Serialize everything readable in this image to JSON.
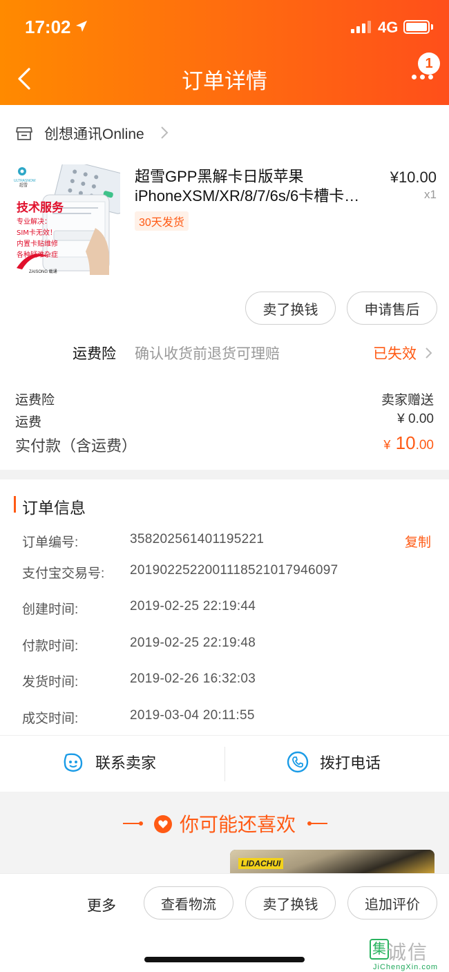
{
  "status_bar": {
    "time": "17:02",
    "network": "4G"
  },
  "nav": {
    "title": "订单详情",
    "badge_count": "1"
  },
  "shop": {
    "name": "创想通讯Online"
  },
  "product": {
    "title_line1": "超雪GPP黑解卡日版苹果",
    "title_line2": "iPhoneXSM/XR/8/7/6s/6卡槽卡…",
    "shipping_tag": "30天发货",
    "price": "¥10.00",
    "quantity": "x1"
  },
  "actions": {
    "sell": "卖了换钱",
    "aftersale": "申请售后"
  },
  "insurance": {
    "label": "运费险",
    "desc": "确认收货前退货可理赔",
    "status": "已失效"
  },
  "fees": [
    {
      "label": "运费险",
      "value": "卖家赠送"
    },
    {
      "label": "运费",
      "value": "¥ 0.00"
    }
  ],
  "total": {
    "label": "实付款（含运费）",
    "currency": "¥",
    "integer": "10",
    "decimal": ".00"
  },
  "order_info": {
    "title": "订单信息",
    "copy_label": "复制",
    "rows": [
      {
        "label": "订单编号:",
        "value": "358202561401195221"
      },
      {
        "label": "支付宝交易号:",
        "value": "2019022522001118521017946097"
      },
      {
        "label": "创建时间:",
        "value": "2019-02-25 22:19:44"
      },
      {
        "label": "付款时间:",
        "value": "2019-02-25 22:19:48"
      },
      {
        "label": "发货时间:",
        "value": "2019-02-26 16:32:03"
      },
      {
        "label": "成交时间:",
        "value": "2019-03-04 20:11:55"
      }
    ]
  },
  "contact": {
    "seller": "联系卖家",
    "call": "拨打电话"
  },
  "recommend": {
    "title": "你可能还喜欢",
    "brand": "LIDACHUI"
  },
  "bottom": {
    "more": "更多",
    "logistics": "查看物流",
    "sell": "卖了换钱",
    "review": "追加评价"
  },
  "thumbnail": {
    "brand": "ULTRASNOW",
    "brand_cn": "超雪",
    "headline": "技术服务",
    "lines": [
      "专业解决：",
      "SIM卡无效！",
      "内置卡贴维修",
      "各种疑难杂症"
    ],
    "footer": "ZAISONG 载诵"
  },
  "watermark": {
    "text": "诚信",
    "sub": "JiChengXin.com",
    "box": "集"
  },
  "colors": {
    "accent": "#ff5a14",
    "header_start": "#ff8a00",
    "header_end": "#ff4f1a"
  }
}
